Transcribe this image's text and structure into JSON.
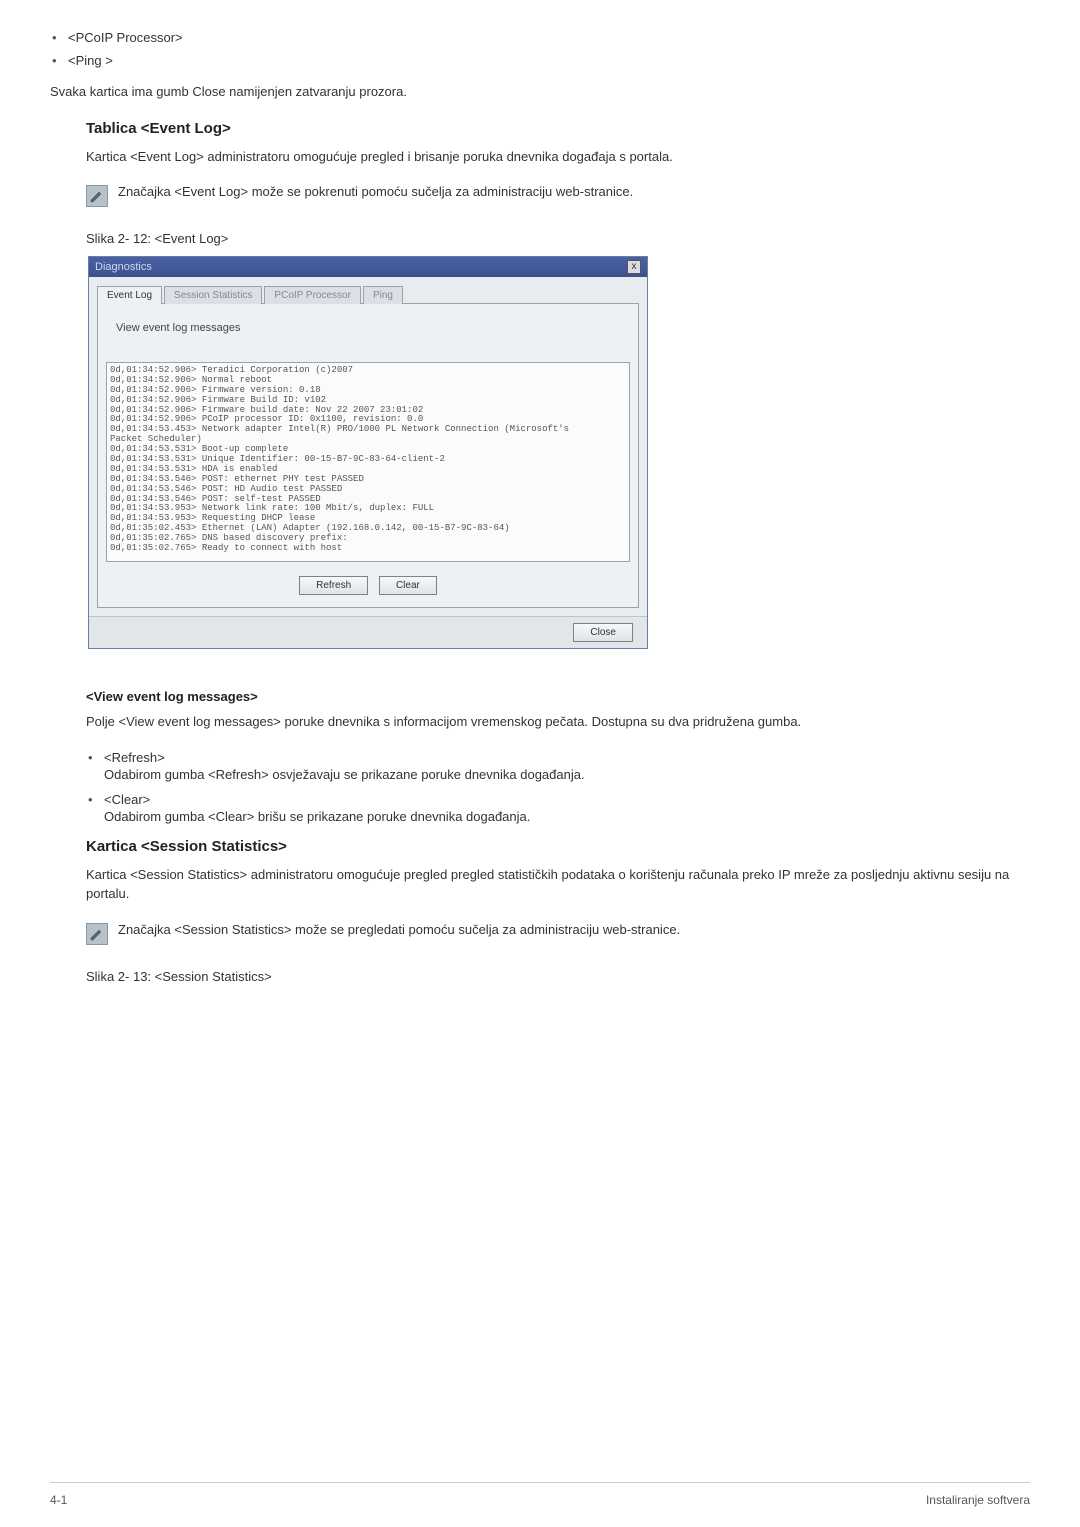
{
  "top_bullets": {
    "item1": "<PCoIP Processor>",
    "item2": "<Ping >"
  },
  "intro_para": "Svaka kartica ima gumb Close namijenjen zatvaranju prozora.",
  "section1": {
    "heading": "Tablica <Event Log>",
    "desc": "Kartica <Event Log> administratoru omogućuje pregled i brisanje poruka dnevnika događaja s portala.",
    "note": "Značajka <Event Log> može se pokrenuti pomoću sučelja za administraciju web-stranice.",
    "caption": "Slika 2- 12: <Event Log>"
  },
  "dialog": {
    "title": "Diagnostics",
    "close_x": "x",
    "tabs": {
      "t1": "Event Log",
      "t2": "Session Statistics",
      "t3": "PCoIP Processor",
      "t4": "Ping"
    },
    "panel_title": "View event log messages",
    "log_text": "0d,01:34:52.906> Teradici Corporation (c)2007\n0d,01:34:52.906> Normal reboot\n0d,01:34:52.906> Firmware version: 0.18\n0d,01:34:52.906> Firmware Build ID: v102\n0d,01:34:52.906> Firmware build date: Nov 22 2007 23:01:02\n0d,01:34:52.906> PCoIP processor ID: 0x1100, revision: 0.0\n0d,01:34:53.453> Network adapter Intel(R) PRO/1000 PL Network Connection (Microsoft's\nPacket Scheduler)\n0d,01:34:53.531> Boot-up complete\n0d,01:34:53.531> Unique Identifier: 00-15-B7-9C-83-64-client-2\n0d,01:34:53.531> HDA is enabled\n0d,01:34:53.546> POST: ethernet PHY test PASSED\n0d,01:34:53.546> POST: HD Audio test PASSED\n0d,01:34:53.546> POST: self-test PASSED\n0d,01:34:53.953> Network link rate: 100 Mbit/s, duplex: FULL\n0d,01:34:53.953> Requesting DHCP lease\n0d,01:35:02.453> Ethernet (LAN) Adapter (192.168.0.142, 00-15-B7-9C-83-64)\n0d,01:35:02.765> DNS based discovery prefix:\n0d,01:35:02.765> Ready to connect with host",
    "refresh_btn": "Refresh",
    "clear_btn": "Clear",
    "close_btn": "Close"
  },
  "section2": {
    "heading": "<View event log messages>",
    "desc": "Polje <View event log messages> poruke dnevnika s informacijom vremenskog pečata. Dostupna su dva pridružena gumba.",
    "items": {
      "b1": "<Refresh>",
      "d1": "Odabirom gumba <Refresh> osvježavaju se prikazane poruke dnevnika događanja.",
      "b2": "<Clear>",
      "d2": "Odabirom gumba <Clear> brišu se prikazane poruke dnevnika događanja."
    }
  },
  "section3": {
    "heading": "Kartica <Session Statistics>",
    "desc": "Kartica <Session Statistics> administratoru omogućuje pregled pregled statističkih podataka o korištenju računala preko IP mreže za posljednju aktivnu sesiju na portalu.",
    "note": "Značajka <Session Statistics> može se pregledati pomoću sučelja za administraciju web-stranice.",
    "caption": "Slika 2- 13: <Session Statistics>"
  },
  "footer": {
    "left": "4-1",
    "right": "Instaliranje softvera"
  }
}
